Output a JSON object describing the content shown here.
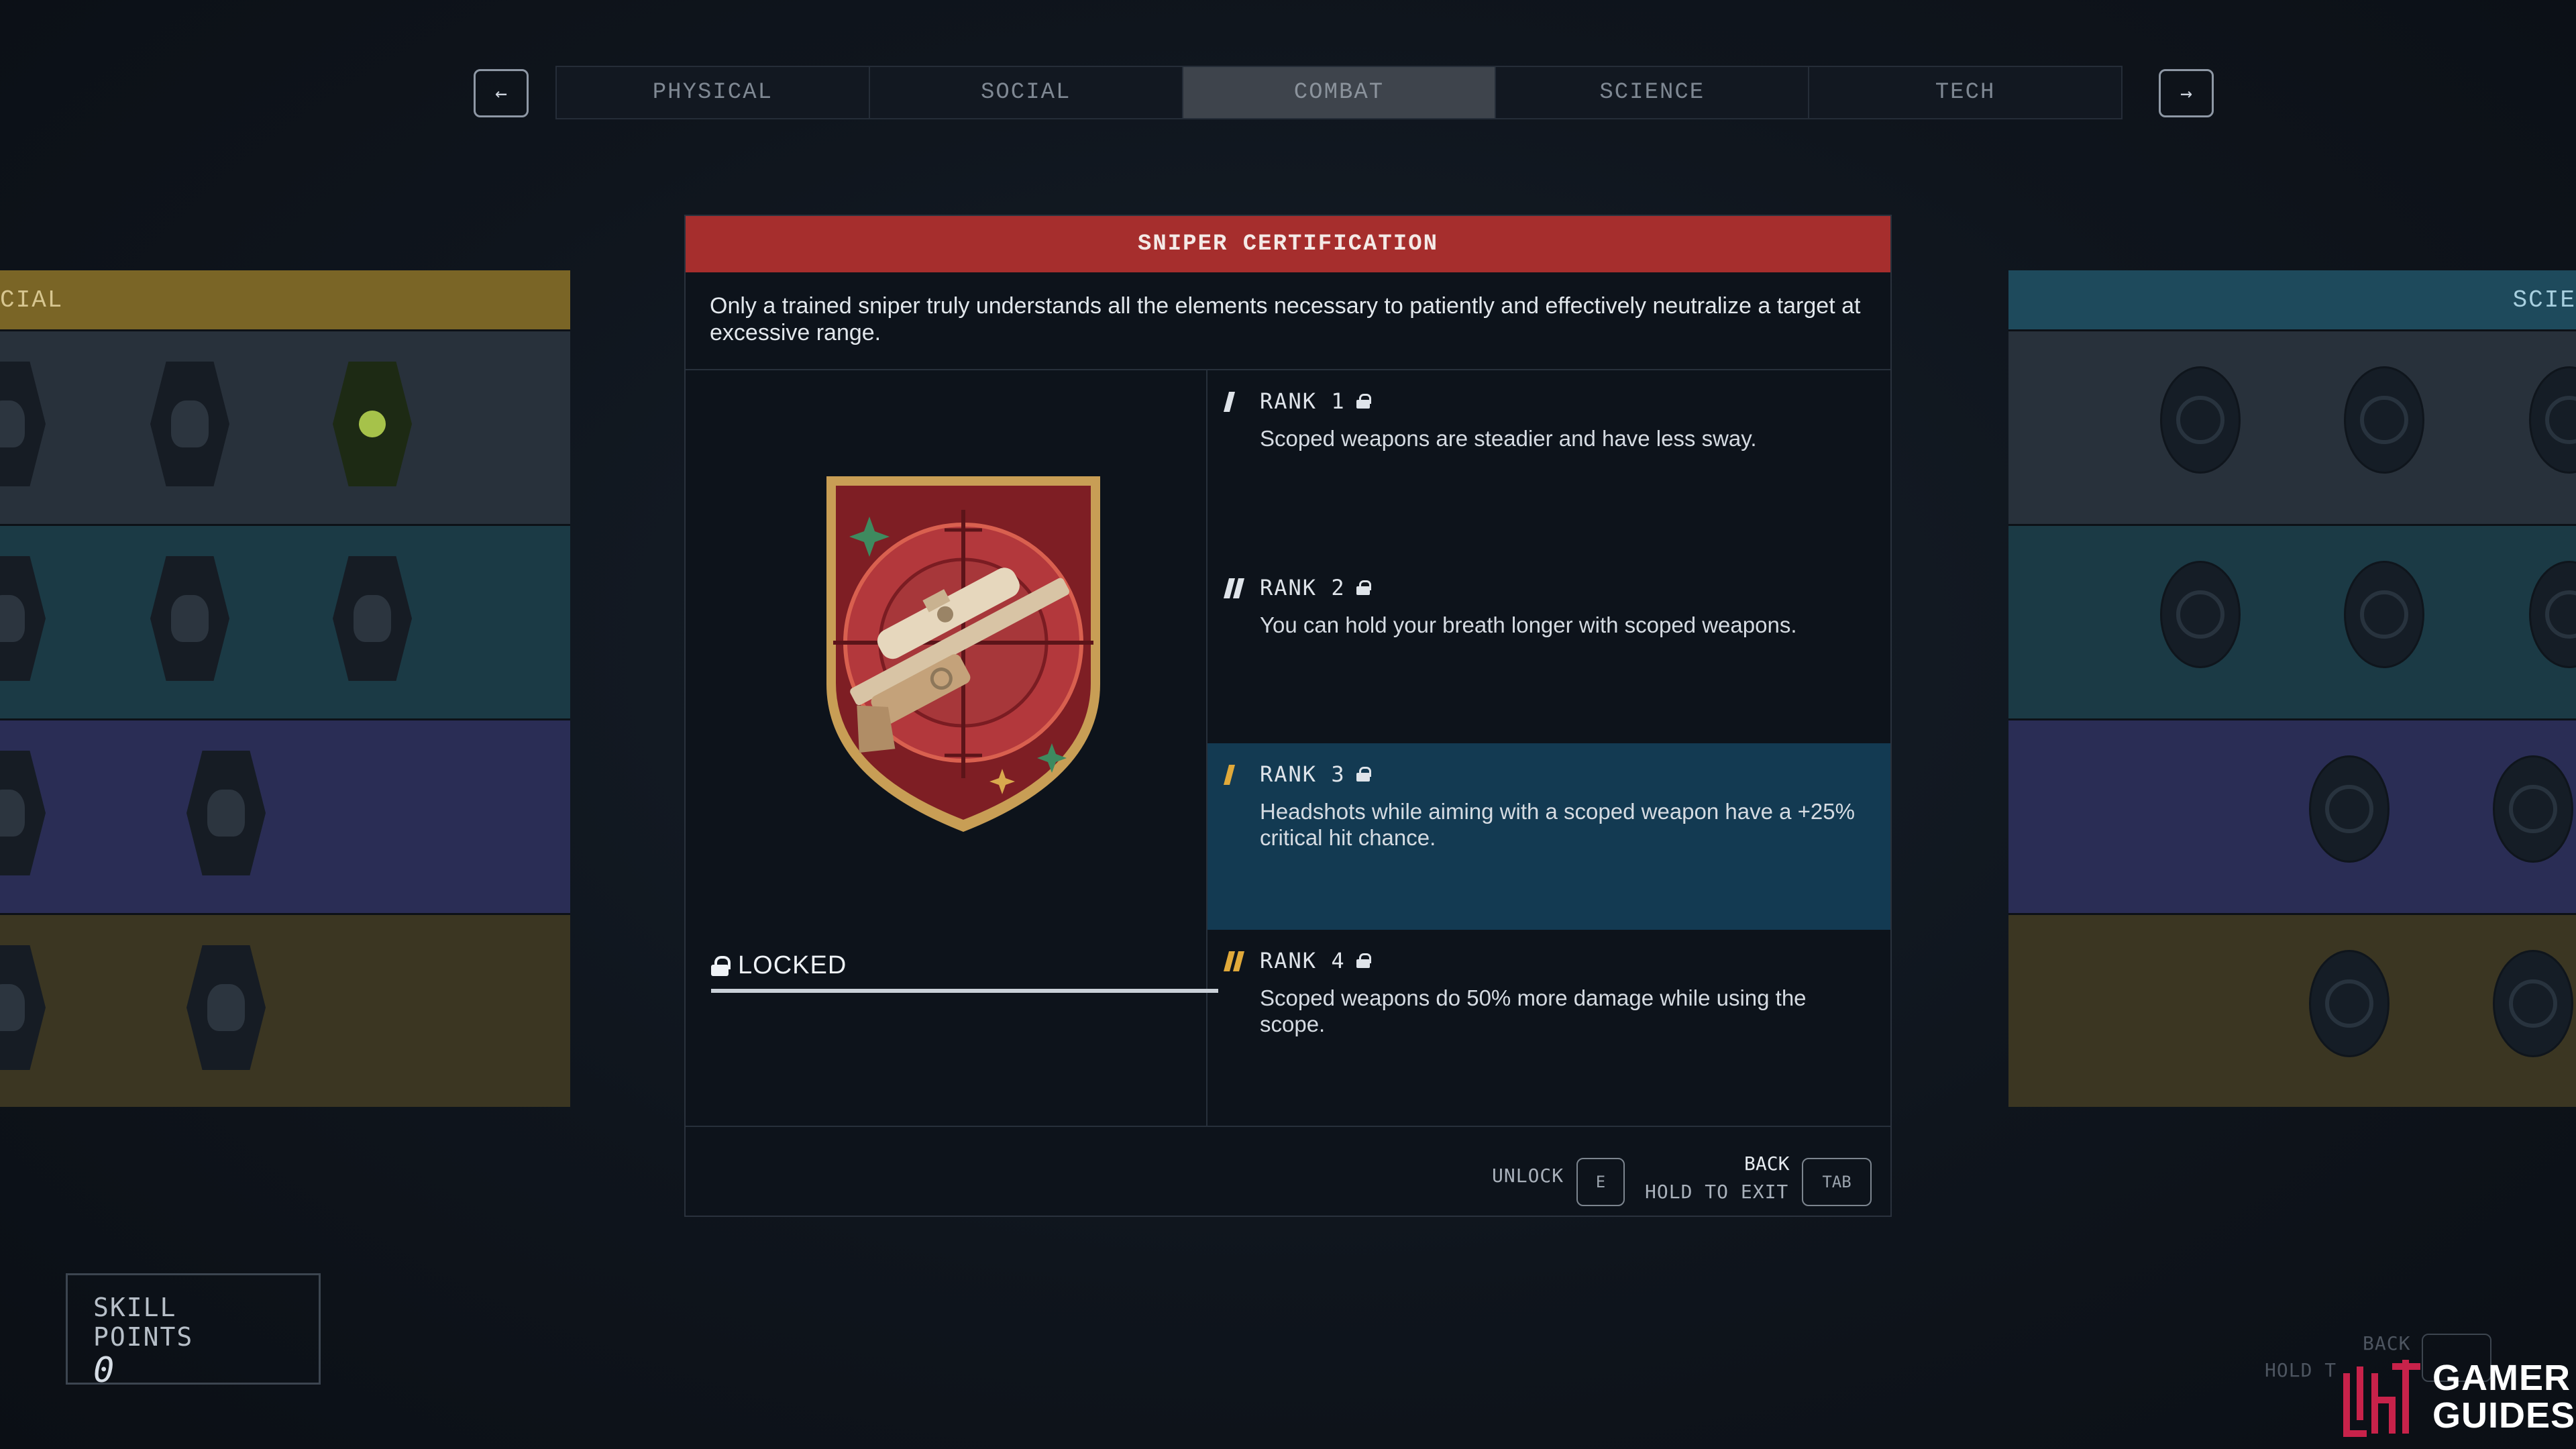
{
  "nav": {
    "prev_arrow": "←",
    "next_arrow": "→",
    "tabs": [
      {
        "label": "PHYSICAL"
      },
      {
        "label": "SOCIAL"
      },
      {
        "label": "COMBAT"
      },
      {
        "label": "SCIENCE"
      },
      {
        "label": "TECH"
      }
    ],
    "active_tab": "COMBAT"
  },
  "left_panel": {
    "header": "CIAL"
  },
  "right_panel": {
    "header": "SCIE"
  },
  "skill": {
    "title": "SNIPER CERTIFICATION",
    "description": "Only a trained sniper truly understands all the elements necessary to patiently and effectively neutralize a target at excessive range.",
    "status": "LOCKED",
    "progress": 1.0,
    "ranks": [
      {
        "label": "RANK 1",
        "text": "Scoped weapons are steadier and have less sway."
      },
      {
        "label": "RANK 2",
        "text": "You can hold your breath longer with scoped weapons."
      },
      {
        "label": "RANK 3",
        "text": "Headshots while aiming with a scoped weapon have a +25% critical hit chance."
      },
      {
        "label": "RANK 4",
        "text": "Scoped weapons do 50% more damage while using the scope."
      }
    ]
  },
  "footer": {
    "unlock_label": "UNLOCK",
    "unlock_key": "E",
    "back_label": "BACK",
    "hold_label": "HOLD TO EXIT",
    "back_key": "TAB"
  },
  "skill_points": {
    "label": "SKILL POINTS",
    "value": "0"
  },
  "ghost_hints": {
    "back": "BACK",
    "hold": "HOLD T",
    "key": "TAB"
  },
  "watermark": {
    "line1": "GAMER",
    "line2": "GUIDES"
  },
  "colors": {
    "title_bar": "#a62e2d",
    "rank_highlight": "#133a52",
    "rank_gold": "#e0a93a",
    "rank_white": "#dfe4ea"
  }
}
